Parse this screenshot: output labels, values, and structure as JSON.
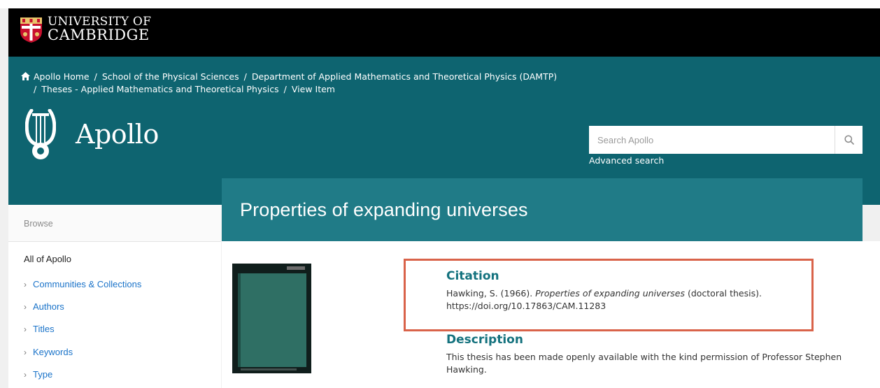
{
  "university": {
    "line1": "UNIVERSITY OF",
    "line2": "CAMBRIDGE"
  },
  "breadcrumbs": [
    "Apollo Home",
    "School of the Physical Sciences",
    "Department of Applied Mathematics and Theoretical Physics (DAMTP)",
    "Theses - Applied Mathematics and Theoretical Physics",
    "View Item"
  ],
  "repository": {
    "name": "Apollo"
  },
  "search": {
    "placeholder": "Search Apollo",
    "advanced_label": "Advanced search"
  },
  "sidebar": {
    "browse_label": "Browse",
    "scope_label": "All of Apollo",
    "items": [
      "Communities & Collections",
      "Authors",
      "Titles",
      "Keywords",
      "Type"
    ]
  },
  "item": {
    "title": "Properties of expanding universes",
    "citation": {
      "heading": "Citation",
      "authors_year": "Hawking, S. (1966).",
      "title_italic": "Properties of expanding universes",
      "type": "(doctoral thesis).",
      "doi": "https://doi.org/10.17863/CAM.11283"
    },
    "description": {
      "heading": "Description",
      "text": "This thesis has been made openly available with the kind permission of Professor Stephen Hawking."
    }
  },
  "colors": {
    "header_black": "#000000",
    "brand_teal": "#0e6470",
    "title_teal": "#207b87",
    "link_blue": "#1a73c9",
    "highlight_red": "#d9634a"
  }
}
